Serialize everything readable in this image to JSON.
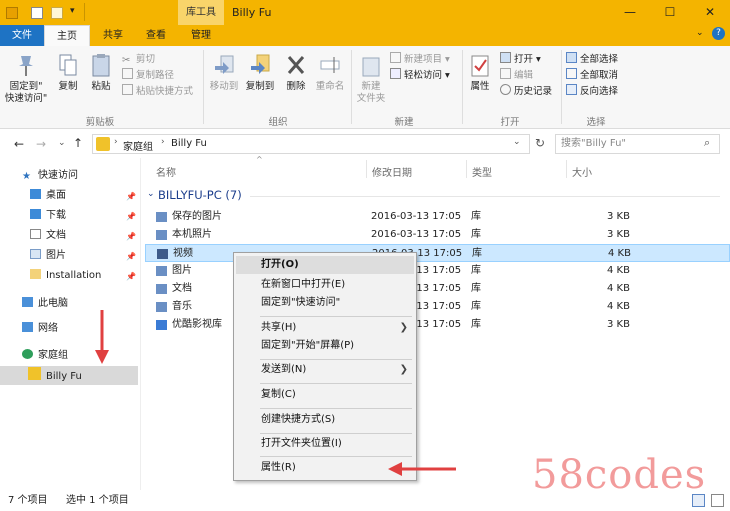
{
  "window": {
    "context_tab": "库工具",
    "title": "Billy Fu",
    "minimize": "—",
    "maximize": "☐",
    "close": "✕"
  },
  "ribbon_tabs": {
    "file": "文件",
    "home": "主页",
    "share": "共享",
    "view": "查看",
    "manage": "管理"
  },
  "ribbon": {
    "clipboard": {
      "pin": "固定到\"\n快速访问\"",
      "pin_line1": "固定到\"",
      "pin_line2": "快速访问\"",
      "copy": "复制",
      "paste": "粘贴",
      "cut": "剪切",
      "copy_path": "复制路径",
      "paste_shortcut": "粘贴快捷方式",
      "label": "剪贴板"
    },
    "organize": {
      "move_to": "移动到",
      "copy_to": "复制到",
      "delete": "删除",
      "rename": "重命名",
      "label": "组织"
    },
    "new": {
      "new_folder_line1": "新建",
      "new_folder_line2": "文件夹",
      "new_item": "新建项目",
      "easy_access": "轻松访问",
      "label": "新建"
    },
    "open": {
      "properties": "属性",
      "open": "打开",
      "edit": "编辑",
      "history": "历史记录",
      "label": "打开"
    },
    "select": {
      "select_all": "全部选择",
      "select_none": "全部取消",
      "invert": "反向选择",
      "label": "选择"
    }
  },
  "address": {
    "path_root": "家庭组",
    "path_leaf": "Billy Fu",
    "search_placeholder": "搜索\"Billy Fu\""
  },
  "nav_pane": {
    "quick_access": "快速访问",
    "desktop": "桌面",
    "downloads": "下载",
    "documents": "文档",
    "pictures": "图片",
    "installation": "Installation",
    "this_pc": "此电脑",
    "network": "网络",
    "homegroup": "家庭组",
    "billy": "Billy Fu"
  },
  "columns": {
    "name": "名称",
    "modified": "修改日期",
    "type": "类型",
    "size": "大小"
  },
  "group_title": "BILLYFU-PC (7)",
  "files": [
    {
      "name": "保存的图片",
      "date": "2016-03-13 17:05",
      "type": "库",
      "size": "3 KB"
    },
    {
      "name": "本机照片",
      "date": "2016-03-13 17:05",
      "type": "库",
      "size": "3 KB"
    },
    {
      "name": "视频",
      "date": "2016-03-13 17:05",
      "type": "库",
      "size": "4 KB"
    },
    {
      "name": "图片",
      "date": "2016-03-13 17:05",
      "type": "库",
      "size": "4 KB"
    },
    {
      "name": "文档",
      "date": "2016-03-13 17:05",
      "type": "库",
      "size": "4 KB"
    },
    {
      "name": "音乐",
      "date": "2016-03-13 17:05",
      "type": "库",
      "size": "4 KB"
    },
    {
      "name": "优酷影视库",
      "date": "2016-03-13 17:05",
      "type": "库",
      "size": "3 KB"
    }
  ],
  "context_menu": {
    "open": "打开(O)",
    "open_new_window": "在新窗口中打开(E)",
    "pin_quick": "固定到\"快速访问\"",
    "share": "共享(H)",
    "pin_start": "固定到\"开始\"屏幕(P)",
    "send_to": "发送到(N)",
    "copy": "复制(C)",
    "create_shortcut": "创建快捷方式(S)",
    "open_location": "打开文件夹位置(I)",
    "properties": "属性(R)"
  },
  "status": {
    "count": "7 个项目",
    "selected": "选中 1 个项目"
  },
  "watermark": "58codes",
  "colors": {
    "title_bar": "#f4b400",
    "file_tab": "#1e73c4",
    "selection": "#cce8ff",
    "arrow": "#e04040"
  }
}
